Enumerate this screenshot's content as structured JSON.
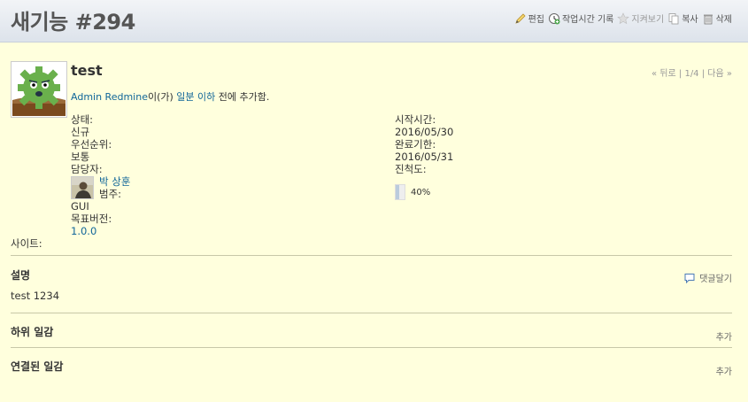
{
  "header": {
    "title": "새기능 #294",
    "actions": {
      "edit": "편집",
      "log_time": "작업시간 기록",
      "watch": "지켜보기",
      "copy": "복사",
      "delete": "삭제"
    }
  },
  "issue": {
    "subject": "test",
    "prevnext": {
      "prev": "« 뒤로",
      "sep1": "|",
      "position": "1/4",
      "sep2": "|",
      "next": "다음 »"
    },
    "author_link": "Admin Redmine",
    "author_suffix": "이(가)",
    "time_ago": "일분 이하",
    "time_suffix": "전에 추가함.",
    "attributes": {
      "status_label": "상태:",
      "status_value": "신규",
      "priority_label": "우선순위:",
      "priority_value": "보통",
      "assignee_label": "담당자:",
      "assignee_value": "박 상훈",
      "category_label": "범주:",
      "category_value": "GUI",
      "version_label": "목표버전:",
      "version_value": "1.0.0",
      "site_label": "사이트:",
      "start_label": "시작시간:",
      "start_value": "2016/05/30",
      "due_label": "완료기한:",
      "due_value": "2016/05/31",
      "done_label": "진척도:",
      "done_value": "40%",
      "done_ratio": 0.4
    }
  },
  "sections": {
    "description_title": "설명",
    "description_text": "test 1234",
    "quote_label": "댓글달기",
    "subtasks_title": "하위 일감",
    "subtasks_add": "추가",
    "relations_title": "연결된 일감",
    "relations_add": "추가"
  }
}
